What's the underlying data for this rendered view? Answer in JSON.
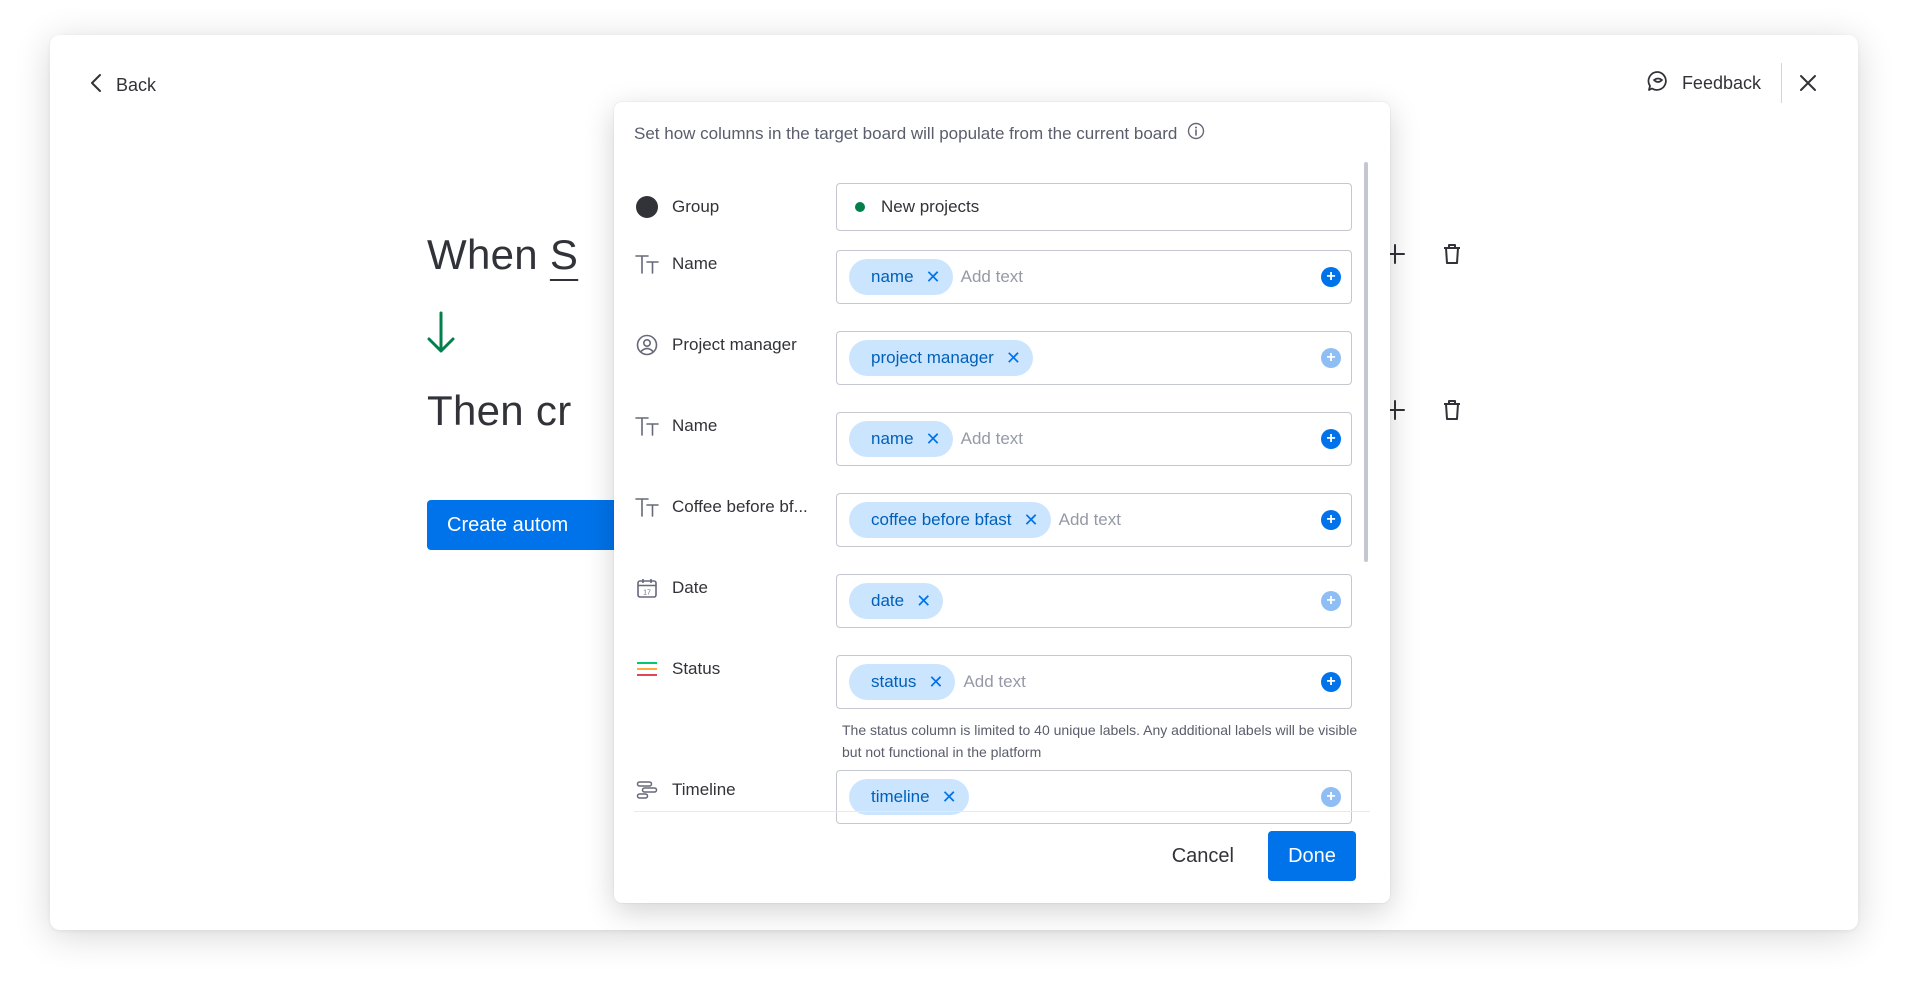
{
  "header": {
    "back_label": "Back",
    "feedback_label": "Feedback"
  },
  "background": {
    "when_prefix": "When ",
    "when_cut": "S",
    "then_text": "Then cr",
    "create_button_label": "Create autom"
  },
  "dialog": {
    "title": "Set how columns in the target board will populate from the current board",
    "group": {
      "label": "Group",
      "value": "New projects",
      "dot_color": "#037f4c"
    },
    "rows": [
      {
        "label": "Name",
        "icon": "text-type-icon",
        "chip": "name",
        "placeholder": "Add text"
      },
      {
        "label": "Project manager",
        "icon": "person-icon",
        "chip": "project manager",
        "placeholder": ""
      },
      {
        "label": "Name",
        "icon": "text-type-icon",
        "chip": "name",
        "placeholder": "Add text"
      },
      {
        "label": "Coffee before bf...",
        "icon": "text-type-icon",
        "chip": "coffee before bfast",
        "placeholder": "Add text"
      },
      {
        "label": "Date",
        "icon": "calendar-icon",
        "chip": "date",
        "placeholder": ""
      },
      {
        "label": "Status",
        "icon": "status-icon",
        "chip": "status",
        "placeholder": "Add text"
      },
      {
        "label": "Timeline",
        "icon": "timeline-icon",
        "chip": "timeline",
        "placeholder": ""
      }
    ],
    "status_note": "The status column is limited to 40 unique labels. Any additional labels will be visible but not functional in the platform",
    "cancel_label": "Cancel",
    "done_label": "Done"
  },
  "colors": {
    "primary": "#0073ea",
    "chip_bg": "#cce5ff",
    "chip_text": "#0060b9",
    "arrow_green": "#037f4c"
  }
}
